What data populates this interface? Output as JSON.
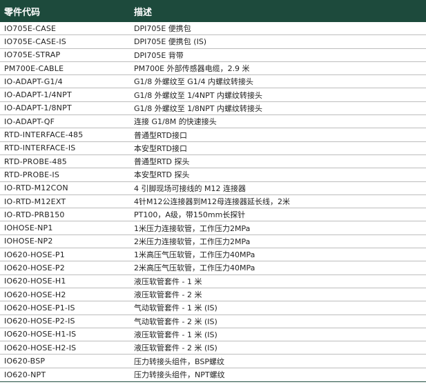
{
  "table": {
    "header": {
      "code": "零件代码",
      "description": "描述"
    },
    "rows": [
      {
        "code": "IO705E-CASE",
        "description": "DPI705E 便携包"
      },
      {
        "code": "IO705E-CASE-IS",
        "description": "DPI705E 便携包 (IS)"
      },
      {
        "code": "IO705E-STRAP",
        "description": "DPI705E 背带"
      },
      {
        "code": "PM700E-CABLE",
        "description": "PM700E 外部传感器电缆，2.9 米"
      },
      {
        "code": "IO-ADAPT-G1/4",
        "description": "G1/8 外螺纹至 G1/4 内螺纹转接头"
      },
      {
        "code": "IO-ADAPT-1/4NPT",
        "description": "G1/8 外螺纹至 1/4NPT 内螺纹转接头"
      },
      {
        "code": "IO-ADAPT-1/8NPT",
        "description": "G1/8 外螺纹至 1/8NPT 内螺纹转接头"
      },
      {
        "code": "IO-ADAPT-QF",
        "description": "连接 G1/8M 的快速接头"
      },
      {
        "code": "RTD-INTERFACE-485",
        "description": "普通型RTD接口"
      },
      {
        "code": "RTD-INTERFACE-IS",
        "description": "本安型RTD接口"
      },
      {
        "code": "RTD-PROBE-485",
        "description": "普通型RTD 探头"
      },
      {
        "code": "RTD-PROBE-IS",
        "description": "本安型RTD 探头"
      },
      {
        "code": "IO-RTD-M12CON",
        "description": "4 引脚现场可接线的 M12 连接器"
      },
      {
        "code": "IO-RTD-M12EXT",
        "description": "4针M12公连接器到M12母连接器延长线，2米"
      },
      {
        "code": "IO-RTD-PRB150",
        "description": "PT100，A级，带150mm长探针"
      },
      {
        "code": "IOHOSE-NP1",
        "description": "1米压力连接软管，工作压力2MPa"
      },
      {
        "code": "IOHOSE-NP2",
        "description": "2米压力连接软管，工作压力2MPa"
      },
      {
        "code": "IO620-HOSE-P1",
        "description": "1米高压气压软管，工作压力40MPa"
      },
      {
        "code": "IO620-HOSE-P2",
        "description": "2米高压气压软管，工作压力40MPa"
      },
      {
        "code": "IO620-HOSE-H1",
        "description": "液压软管套件 - 1 米"
      },
      {
        "code": "IO620-HOSE-H2",
        "description": "液压软管套件 - 2 米"
      },
      {
        "code": "IO620-HOSE-P1-IS",
        "description": "气动软管套件 - 1 米 (IS)"
      },
      {
        "code": "IO620-HOSE-P2-IS",
        "description": "气动软管套件 - 2 米 (IS)"
      },
      {
        "code": "IO620-HOSE-H1-IS",
        "description": "液压软管套件 - 1 米 (IS)"
      },
      {
        "code": "IO620-HOSE-H2-IS",
        "description": "液压软管套件 - 2 米 (IS)"
      },
      {
        "code": "IO620-BSP",
        "description": "压力转接头组件，BSP螺纹"
      },
      {
        "code": "IO620-NPT",
        "description": "压力转接头组件，NPT螺纹"
      }
    ]
  }
}
